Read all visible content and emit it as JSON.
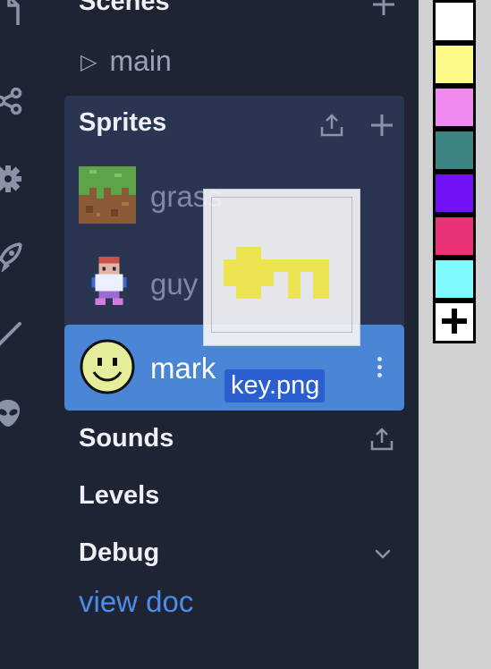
{
  "rail": {
    "icons": [
      "file-icon",
      "share-icon",
      "gear-icon",
      "rocket-icon",
      "pencil-icon",
      "alien-icon"
    ]
  },
  "scenes": {
    "title": "Scenes",
    "items": [
      {
        "label": "main"
      }
    ]
  },
  "sprites": {
    "title": "Sprites",
    "items": [
      {
        "label": "grass",
        "icon": "grass-block-sprite"
      },
      {
        "label": "guy",
        "icon": "guy-sprite"
      },
      {
        "label": "mark",
        "icon": "smiley-sprite",
        "selected": true
      }
    ]
  },
  "sounds": {
    "title": "Sounds"
  },
  "levels": {
    "title": "Levels"
  },
  "debug": {
    "title": "Debug"
  },
  "links": {
    "view_doc": "view doc"
  },
  "drag": {
    "filename": "key.png",
    "icon": "key-sprite"
  },
  "palette": {
    "colors": [
      "#ffffff",
      "#fefa88",
      "#ef8af0",
      "#3c8582",
      "#7113f5",
      "#ea3279",
      "#7dfbfe"
    ],
    "add_symbol": "+"
  }
}
